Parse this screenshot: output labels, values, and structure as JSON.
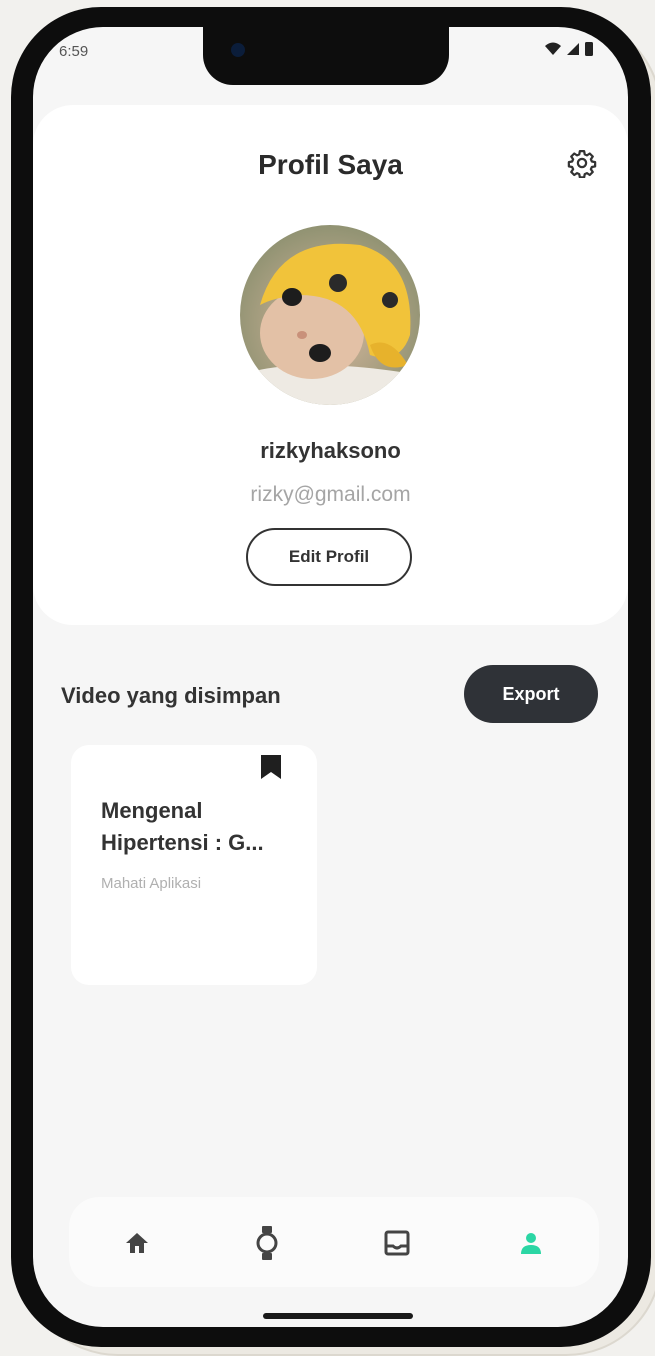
{
  "status_bar": {
    "time": "6:59"
  },
  "header": {
    "title": "Profil Saya",
    "settings_icon": "gear-icon"
  },
  "profile": {
    "avatar_description_icon": "avatar-photo-icon",
    "username": "rizkyhaksono",
    "email": "rizky@gmail.com",
    "edit_label": "Edit Profil"
  },
  "saved_videos": {
    "title": "Video yang disimpan",
    "export_label": "Export",
    "items": [
      {
        "title": "Mengenal\nHipertensi : G...",
        "source": "Mahati Aplikasi",
        "icon": "bookmark-icon"
      }
    ]
  },
  "bottom_nav": {
    "items": [
      {
        "icon": "home-icon",
        "active": false
      },
      {
        "icon": "watch-icon",
        "active": false
      },
      {
        "icon": "inbox-icon",
        "active": false
      },
      {
        "icon": "person-icon",
        "active": true
      }
    ]
  },
  "colors": {
    "accent": "#2bd6a4",
    "dark_button": "#2f3237",
    "text_primary": "#333333",
    "text_muted": "#a5a5a5",
    "nav_icon": "#444444"
  }
}
